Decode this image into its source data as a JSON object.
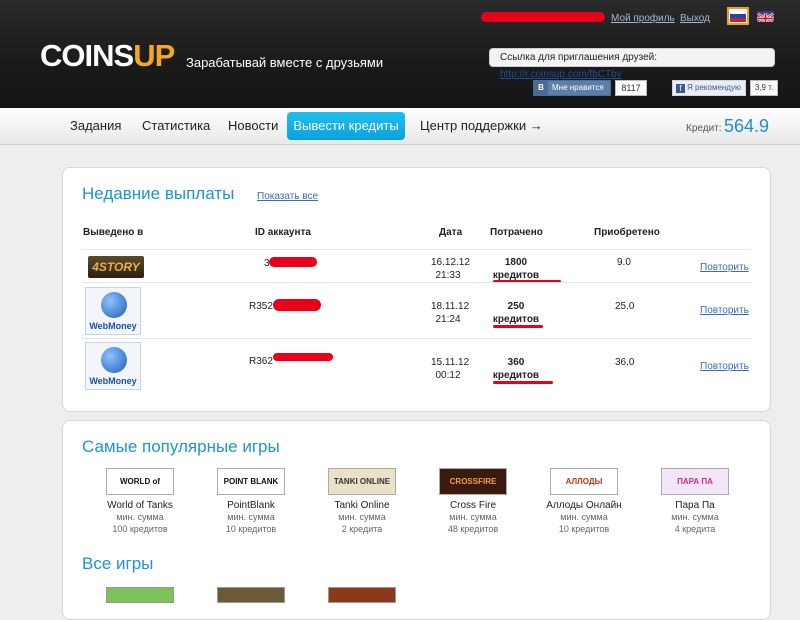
{
  "header": {
    "logo_main": "COINS",
    "logo_up": "UP",
    "tagline": "Зарабатывай вместе с друзьями",
    "profile_link": "Мой профиль",
    "logout_link": "Выход",
    "invite_label": "Ссылка для приглашения друзей:",
    "invite_url": "http://r.coinsup.com/fbCTbv",
    "vk_like_label": "Мне нравится",
    "vk_count": "8117",
    "fb_recommend_label": "Я рекомендую",
    "fb_count": "3,9 т."
  },
  "nav": {
    "items": [
      "Задания",
      "Статистика",
      "Новости",
      "Вывести кредиты",
      "Центр поддержки →"
    ],
    "credit_label": "Кредит:",
    "credit_value": "564.9"
  },
  "payouts": {
    "title": "Недавние выплаты",
    "show_all": "Показать все",
    "columns": [
      "Выведено в",
      "ID аккаунта",
      "Дата",
      "Потрачено",
      "Приобретено"
    ],
    "rows": [
      {
        "logo": "4STORY",
        "account": "3",
        "date": "16.12.12",
        "time": "21:33",
        "spent": "1800",
        "spent_unit": "кредитов",
        "received": "9.0",
        "action": "Повторить"
      },
      {
        "logo": "WebMoney",
        "account": "R352",
        "date": "18.11.12",
        "time": "21:24",
        "spent": "250",
        "spent_unit": "кредитов",
        "received": "25.0",
        "action": "Повторить"
      },
      {
        "logo": "WebMoney",
        "account": "R362",
        "date": "15.11.12",
        "time": "00:12",
        "spent": "360",
        "spent_unit": "кредитов",
        "received": "36.0",
        "action": "Повторить"
      }
    ]
  },
  "games": {
    "title": "Самые популярные игры",
    "all_title": "Все игры",
    "min_label": "мин. сумма",
    "items": [
      {
        "tile": "WORLD of TANKS",
        "name": "World of Tanks",
        "min": "100 кредитов"
      },
      {
        "tile": "POINT BLANK",
        "name": "PointBlank",
        "min": "10 кредитов"
      },
      {
        "tile": "TANKI ONLINE",
        "name": "Tanki Online",
        "min": "2 кредита"
      },
      {
        "tile": "CROSSFIRE",
        "name": "Cross Fire",
        "min": "48 кредитов"
      },
      {
        "tile": "АЛЛОДЫ",
        "name": "Аллоды Онлайн",
        "min": "10 кредитов"
      },
      {
        "tile": "ПАРА ПА",
        "name": "Пара Па",
        "min": "4 кредита"
      }
    ]
  },
  "colors": {
    "accent_blue": "#1c95d2",
    "nav_active": "#0aa1dc",
    "logo_up": "#f4a81b",
    "redaction": "#e8001a"
  }
}
